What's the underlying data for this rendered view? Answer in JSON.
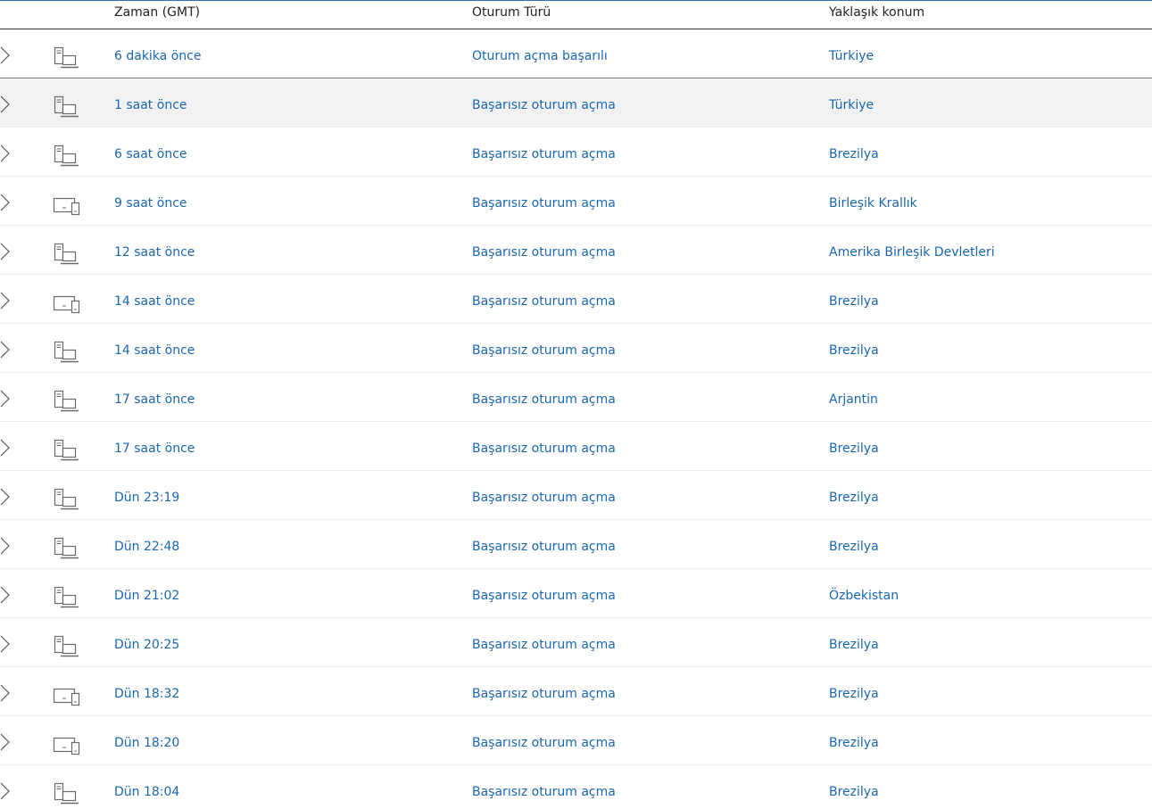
{
  "columns": {
    "time": "Zaman (GMT)",
    "type": "Oturum Türü",
    "location": "Yaklaşık konum"
  },
  "icons": {
    "expand": "chevron-right-icon",
    "desktop": "desktop-computer-icon",
    "devices": "multi-device-icon"
  },
  "colors": {
    "link": "#1a66b0",
    "accent": "#2b6fc2",
    "selected_row": "#f2f2f2",
    "icon": "#6b6b6b"
  },
  "rows": [
    {
      "time": "6 dakika önce",
      "type": "Oturum açma başarılı",
      "location": "Türkiye",
      "device": "desktop"
    },
    {
      "time": "1 saat önce",
      "type": "Başarısız oturum açma",
      "location": "Türkiye",
      "device": "desktop"
    },
    {
      "time": "6 saat önce",
      "type": "Başarısız oturum açma",
      "location": "Brezilya",
      "device": "desktop"
    },
    {
      "time": "9 saat önce",
      "type": "Başarısız oturum açma",
      "location": "Birleşik Krallık",
      "device": "devices"
    },
    {
      "time": "12 saat önce",
      "type": "Başarısız oturum açma",
      "location": "Amerika Birleşik Devletleri",
      "device": "desktop"
    },
    {
      "time": "14 saat önce",
      "type": "Başarısız oturum açma",
      "location": "Brezilya",
      "device": "devices"
    },
    {
      "time": "14 saat önce",
      "type": "Başarısız oturum açma",
      "location": "Brezilya",
      "device": "desktop"
    },
    {
      "time": "17 saat önce",
      "type": "Başarısız oturum açma",
      "location": "Arjantin",
      "device": "desktop"
    },
    {
      "time": "17 saat önce",
      "type": "Başarısız oturum açma",
      "location": "Brezilya",
      "device": "desktop"
    },
    {
      "time": "Dün 23:19",
      "type": "Başarısız oturum açma",
      "location": "Brezilya",
      "device": "desktop"
    },
    {
      "time": "Dün 22:48",
      "type": "Başarısız oturum açma",
      "location": "Brezilya",
      "device": "desktop"
    },
    {
      "time": "Dün 21:02",
      "type": "Başarısız oturum açma",
      "location": "Özbekistan",
      "device": "desktop"
    },
    {
      "time": "Dün 20:25",
      "type": "Başarısız oturum açma",
      "location": "Brezilya",
      "device": "desktop"
    },
    {
      "time": "Dün 18:32",
      "type": "Başarısız oturum açma",
      "location": "Brezilya",
      "device": "devices"
    },
    {
      "time": "Dün 18:20",
      "type": "Başarısız oturum açma",
      "location": "Brezilya",
      "device": "devices"
    },
    {
      "time": "Dün 18:04",
      "type": "Başarısız oturum açma",
      "location": "Brezilya",
      "device": "desktop"
    }
  ]
}
